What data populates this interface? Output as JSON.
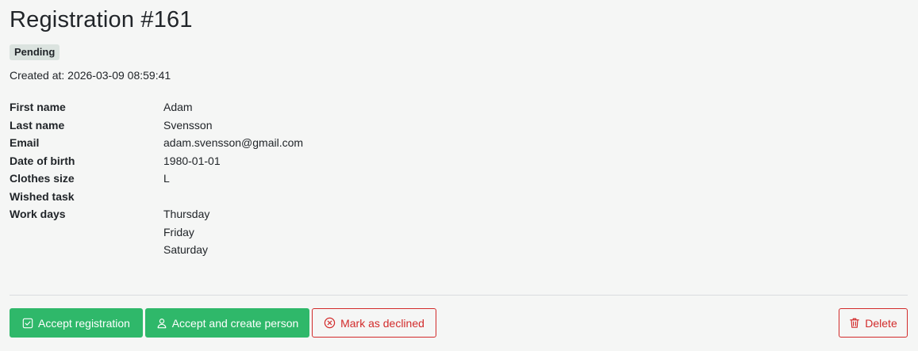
{
  "header": {
    "title": "Registration #161",
    "status_badge": "Pending",
    "created_label": "Created at: 2026-03-09 08:59:41"
  },
  "fields": [
    {
      "label": "First name",
      "values": [
        "Adam"
      ]
    },
    {
      "label": "Last name",
      "values": [
        "Svensson"
      ]
    },
    {
      "label": "Email",
      "values": [
        "adam.svensson@gmail.com"
      ]
    },
    {
      "label": "Date of birth",
      "values": [
        "1980-01-01"
      ]
    },
    {
      "label": "Clothes size",
      "values": [
        "L"
      ]
    },
    {
      "label": "Wished task",
      "values": [
        ""
      ]
    },
    {
      "label": "Work days",
      "values": [
        "Thursday",
        "Friday",
        "Saturday"
      ]
    }
  ],
  "actions": {
    "accept_label": "Accept registration",
    "accept_icon": "check-square-icon",
    "accept_create_label": "Accept and create person",
    "accept_create_icon": "person-icon",
    "decline_label": "Mark as declined",
    "decline_icon": "x-circle-icon",
    "delete_label": "Delete",
    "delete_icon": "trash-icon"
  },
  "colors": {
    "background": "#f5f6f5",
    "success": "#2fb86a",
    "danger": "#d22b2b",
    "badge": "#dbe3df"
  }
}
